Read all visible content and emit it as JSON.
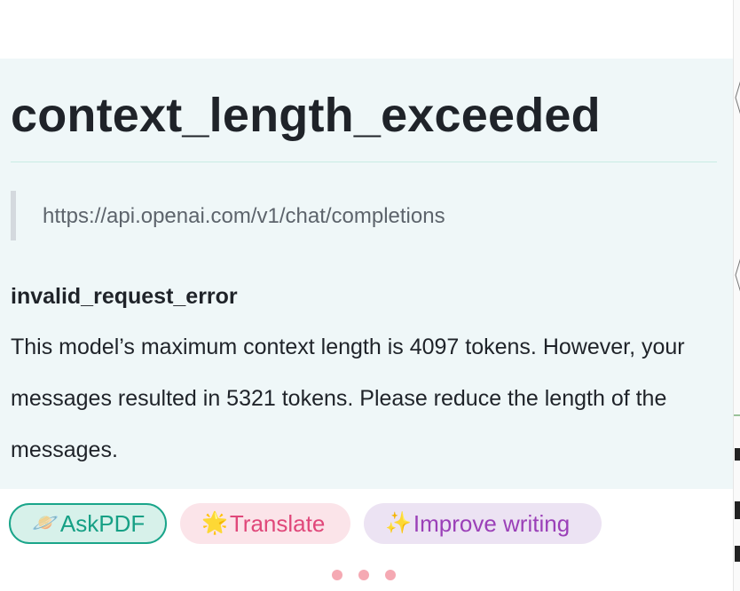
{
  "error": {
    "title": "context_length_exceeded",
    "url": "https://api.openai.com/v1/chat/completions",
    "type": "invalid_request_error",
    "message": "This model’s maximum context length is 4097 tokens. However, your messages resulted in 5321 tokens. Please reduce the length of the messages."
  },
  "actions": {
    "askpdf": {
      "emoji": "🪐",
      "label": "AskPDF"
    },
    "translate": {
      "emoji": "🌟",
      "label": "Translate"
    },
    "improve": {
      "emoji": "✨",
      "label": "Improve writing"
    }
  },
  "colors": {
    "panel_bg": "#eff7f8",
    "askpdf": "#16a085",
    "translate": "#e0487a",
    "improve": "#9b40b8",
    "dots": "#f5a9b3"
  },
  "icons": [
    "ringed-planet-icon",
    "glowing-star-icon",
    "sparkles-icon",
    "typing-indicator-icon"
  ]
}
